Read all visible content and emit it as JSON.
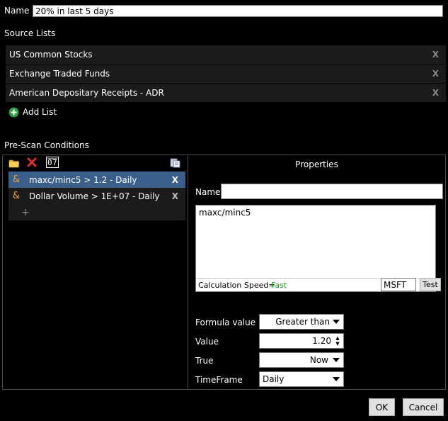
{
  "name": {
    "label": "Name",
    "value": "20% in last 5 days"
  },
  "source_lists": {
    "title": "Source Lists",
    "items": [
      {
        "label": "US Common Stocks",
        "remove": "X"
      },
      {
        "label": "Exchange Traded Funds",
        "remove": "X"
      },
      {
        "label": "American Depositary Receipts - ADR",
        "remove": "X"
      }
    ],
    "add_label": "Add List"
  },
  "prescan": {
    "title": "Pre-Scan Conditions",
    "toolbar_icons": [
      "folder-icon",
      "delete-icon",
      "formula-icon",
      "paste-icon"
    ],
    "conditions": [
      {
        "amp": "&",
        "text": "maxc/minc5 > 1.2 - Daily",
        "remove": "X",
        "selected": true
      },
      {
        "amp": "&",
        "text": "Dollar Volume  > 1E+07 - Daily",
        "remove": "X",
        "selected": false
      }
    ],
    "add_symbol": "+"
  },
  "properties": {
    "title": "Properties",
    "name_label": "Name",
    "name_value": "",
    "formula": "maxc/minc5",
    "calc_speed_label": "Calculation Speed=",
    "calc_speed_value": "Fast",
    "test_symbol": "MSFT",
    "test_button": "Test",
    "formula_value_label": "Formula value",
    "formula_value_option": "Greater than",
    "value_label": "Value",
    "value": "1.20",
    "true_label": "True",
    "true_option": "Now",
    "timeframe_label": "TimeFrame",
    "timeframe_option": "Daily"
  },
  "buttons": {
    "ok": "OK",
    "cancel": "Cancel"
  },
  "colors": {
    "accent_green": "#2ea043",
    "fast_green": "#1f9d1f",
    "selection": "#3a5f8a",
    "amp": "#e6a23c"
  }
}
